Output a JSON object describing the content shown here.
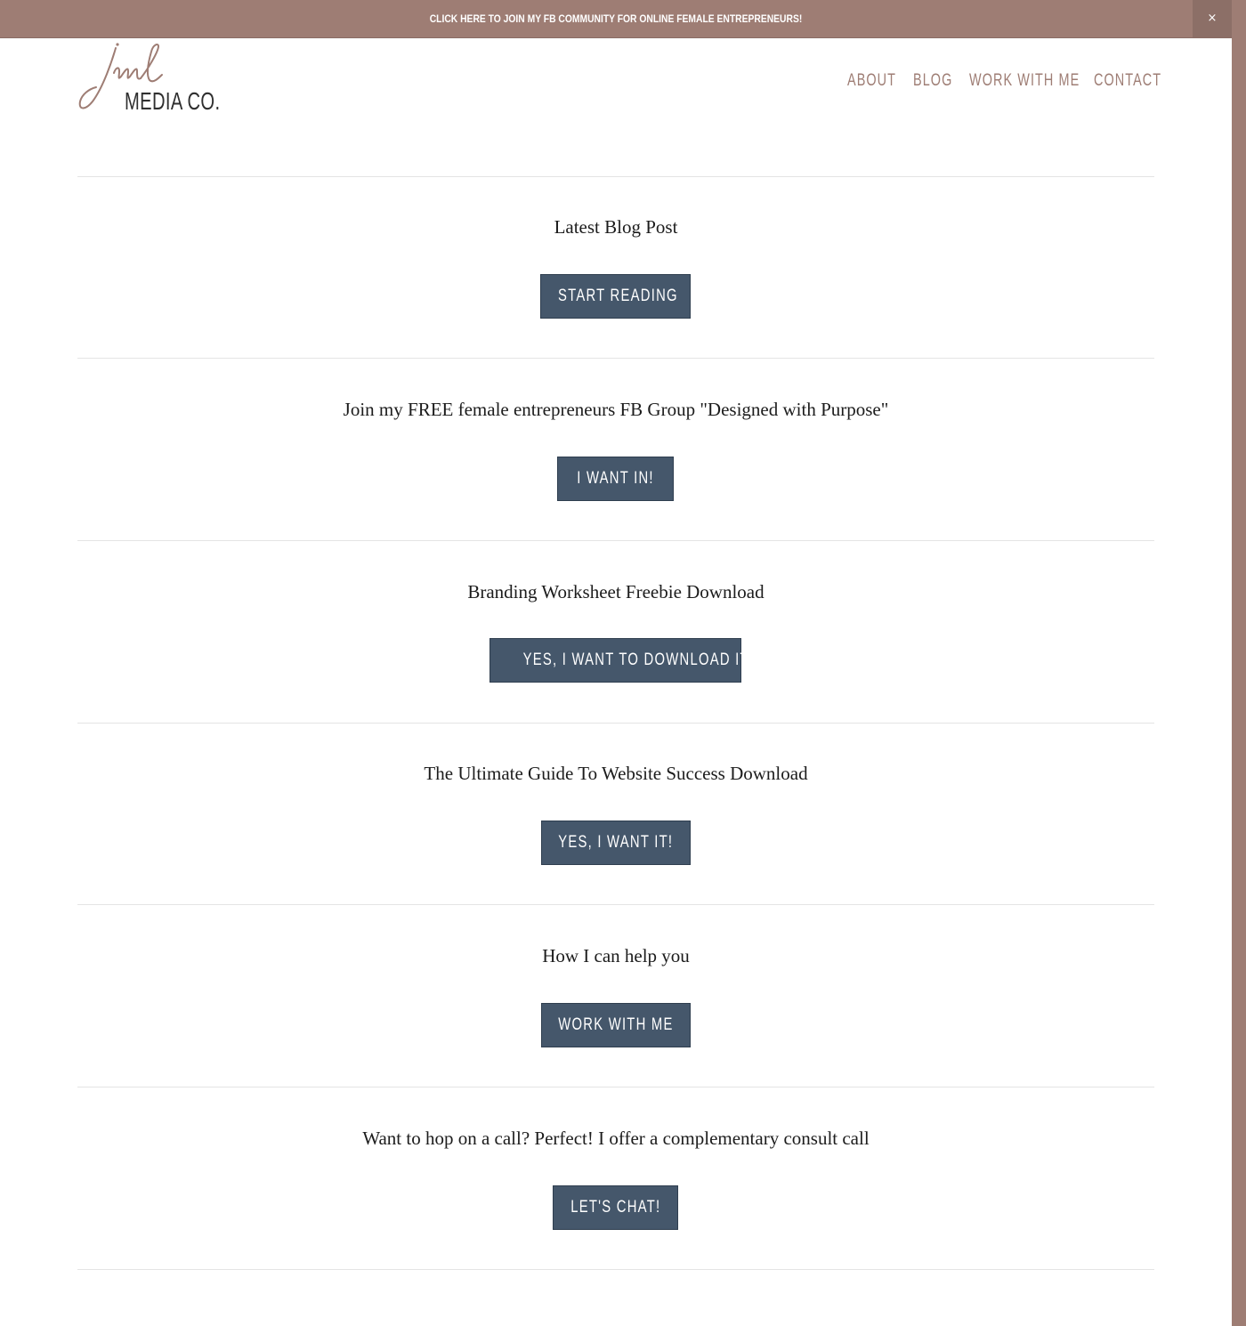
{
  "announcement": {
    "text": "CLICK HERE TO JOIN MY FB COMMUNITY FOR ONLINE FEMALE ENTREPRENEURS!",
    "close_label": "×"
  },
  "logo": {
    "script_text": "jml",
    "name": "MEDIA CO."
  },
  "nav": {
    "items": [
      {
        "label": "ABOUT"
      },
      {
        "label": "BLOG"
      },
      {
        "label": "WORK WITH ME"
      },
      {
        "label": "CONTACT"
      }
    ]
  },
  "sections": [
    {
      "title": "Latest Blog Post",
      "button": "START READING"
    },
    {
      "title": "Join my FREE female entrepreneurs FB Group \"Designed with Purpose\"",
      "button": "I WANT IN!"
    },
    {
      "title": "Branding Worksheet Freebie Download",
      "button": "YES, I WANT TO DOWNLOAD IT!"
    },
    {
      "title": "The Ultimate Guide To Website Success Download",
      "button": "YES, I WANT IT!"
    },
    {
      "title": "How I can help you",
      "button": "WORK WITH ME"
    },
    {
      "title": "Want to hop on a call? Perfect! I offer a complementary consult call",
      "button": "LET'S CHAT!"
    }
  ],
  "colors": {
    "brand": "#9e7d74",
    "button": "#45576b",
    "divider": "#e4e4e4"
  }
}
